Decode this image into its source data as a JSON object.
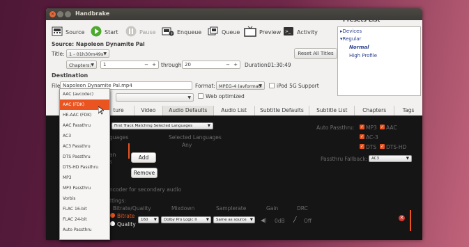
{
  "window": {
    "title": "Handbrake"
  },
  "toolbar": {
    "source": "Source",
    "start": "Start",
    "pause": "Pause",
    "enqueue": "Enqueue",
    "queue": "Queue",
    "preview": "Preview",
    "activity": "Activity"
  },
  "source": {
    "label": "Source:",
    "value": "Napoleon Dynamite Pal"
  },
  "title_row": {
    "label": "Title:",
    "title_value": "1 - 01h30m49s",
    "reset_all_titles": "Reset All Titles"
  },
  "chapters_row": {
    "mode": "Chapters:",
    "from": "1",
    "through_label": "through",
    "to": "20",
    "duration_label": "Duration:",
    "duration": "01:30:49"
  },
  "destination": {
    "heading": "Destination",
    "file_label": "File:",
    "file_value": "Napoleon Dynamite Pal.mp4",
    "format_label": "Format:",
    "format_value": "MPEG-4 (avformat)",
    "ipod_label": "iPod 5G Support",
    "web_optimized_label": "Web optimized"
  },
  "presets": {
    "heading": "Presets List",
    "items": [
      "Devices",
      "Regular",
      "Normal",
      "High Profile"
    ]
  },
  "tabs": [
    "ture",
    "Video",
    "Audio Defaults",
    "Audio List",
    "Subtitle Defaults",
    "Subtitle List",
    "Chapters",
    "Tags"
  ],
  "audio": {
    "track_select": "First Track Matching Selected Languages",
    "languages_left": "guages",
    "selected_languages_heading": "Selected Languages",
    "selected_languages_value": "Any",
    "an_label": "an",
    "s_label": "s",
    "add": "Add",
    "remove": "Remove",
    "secondary_label": "ncoder for secondary audio",
    "settings_label": "ttings:",
    "auto_passthru_label": "Auto Passthru:",
    "passthru": [
      "MP3",
      "AAC",
      "AC-3",
      "DTS",
      "DTS-HD"
    ],
    "passthru_fallback_label": "Passthru Fallback:",
    "passthru_fallback_value": "AC3",
    "cols": [
      "Bitrate/Quality",
      "Mixdown",
      "Samplerate",
      "Gain",
      "DRC"
    ],
    "bitrate_label": "Bitrate",
    "quality_label": "Quality",
    "bitrate_value": "160",
    "mixdown_value": "Dolby Pro Logic II",
    "samplerate_value": "Same as source",
    "gain_value": "0dB",
    "drc_value": "Off"
  },
  "encoder_menu": {
    "items": [
      "AAC (avcodec)",
      "AAC (FDK)",
      "HE-AAC (FDK)",
      "AAC Passthru",
      "AC3",
      "AC3 Passthru",
      "DTS Passthru",
      "DTS-HD Passthru",
      "MP3",
      "MP3 Passthru",
      "Vorbis",
      "FLAC 16-bit",
      "FLAC 24-bit",
      "Auto Passthru"
    ],
    "selected": "AAC (FDK)"
  },
  "colors": {
    "accent": "#e95420",
    "titlebar": "#3c3b37",
    "panel": "#151515"
  }
}
